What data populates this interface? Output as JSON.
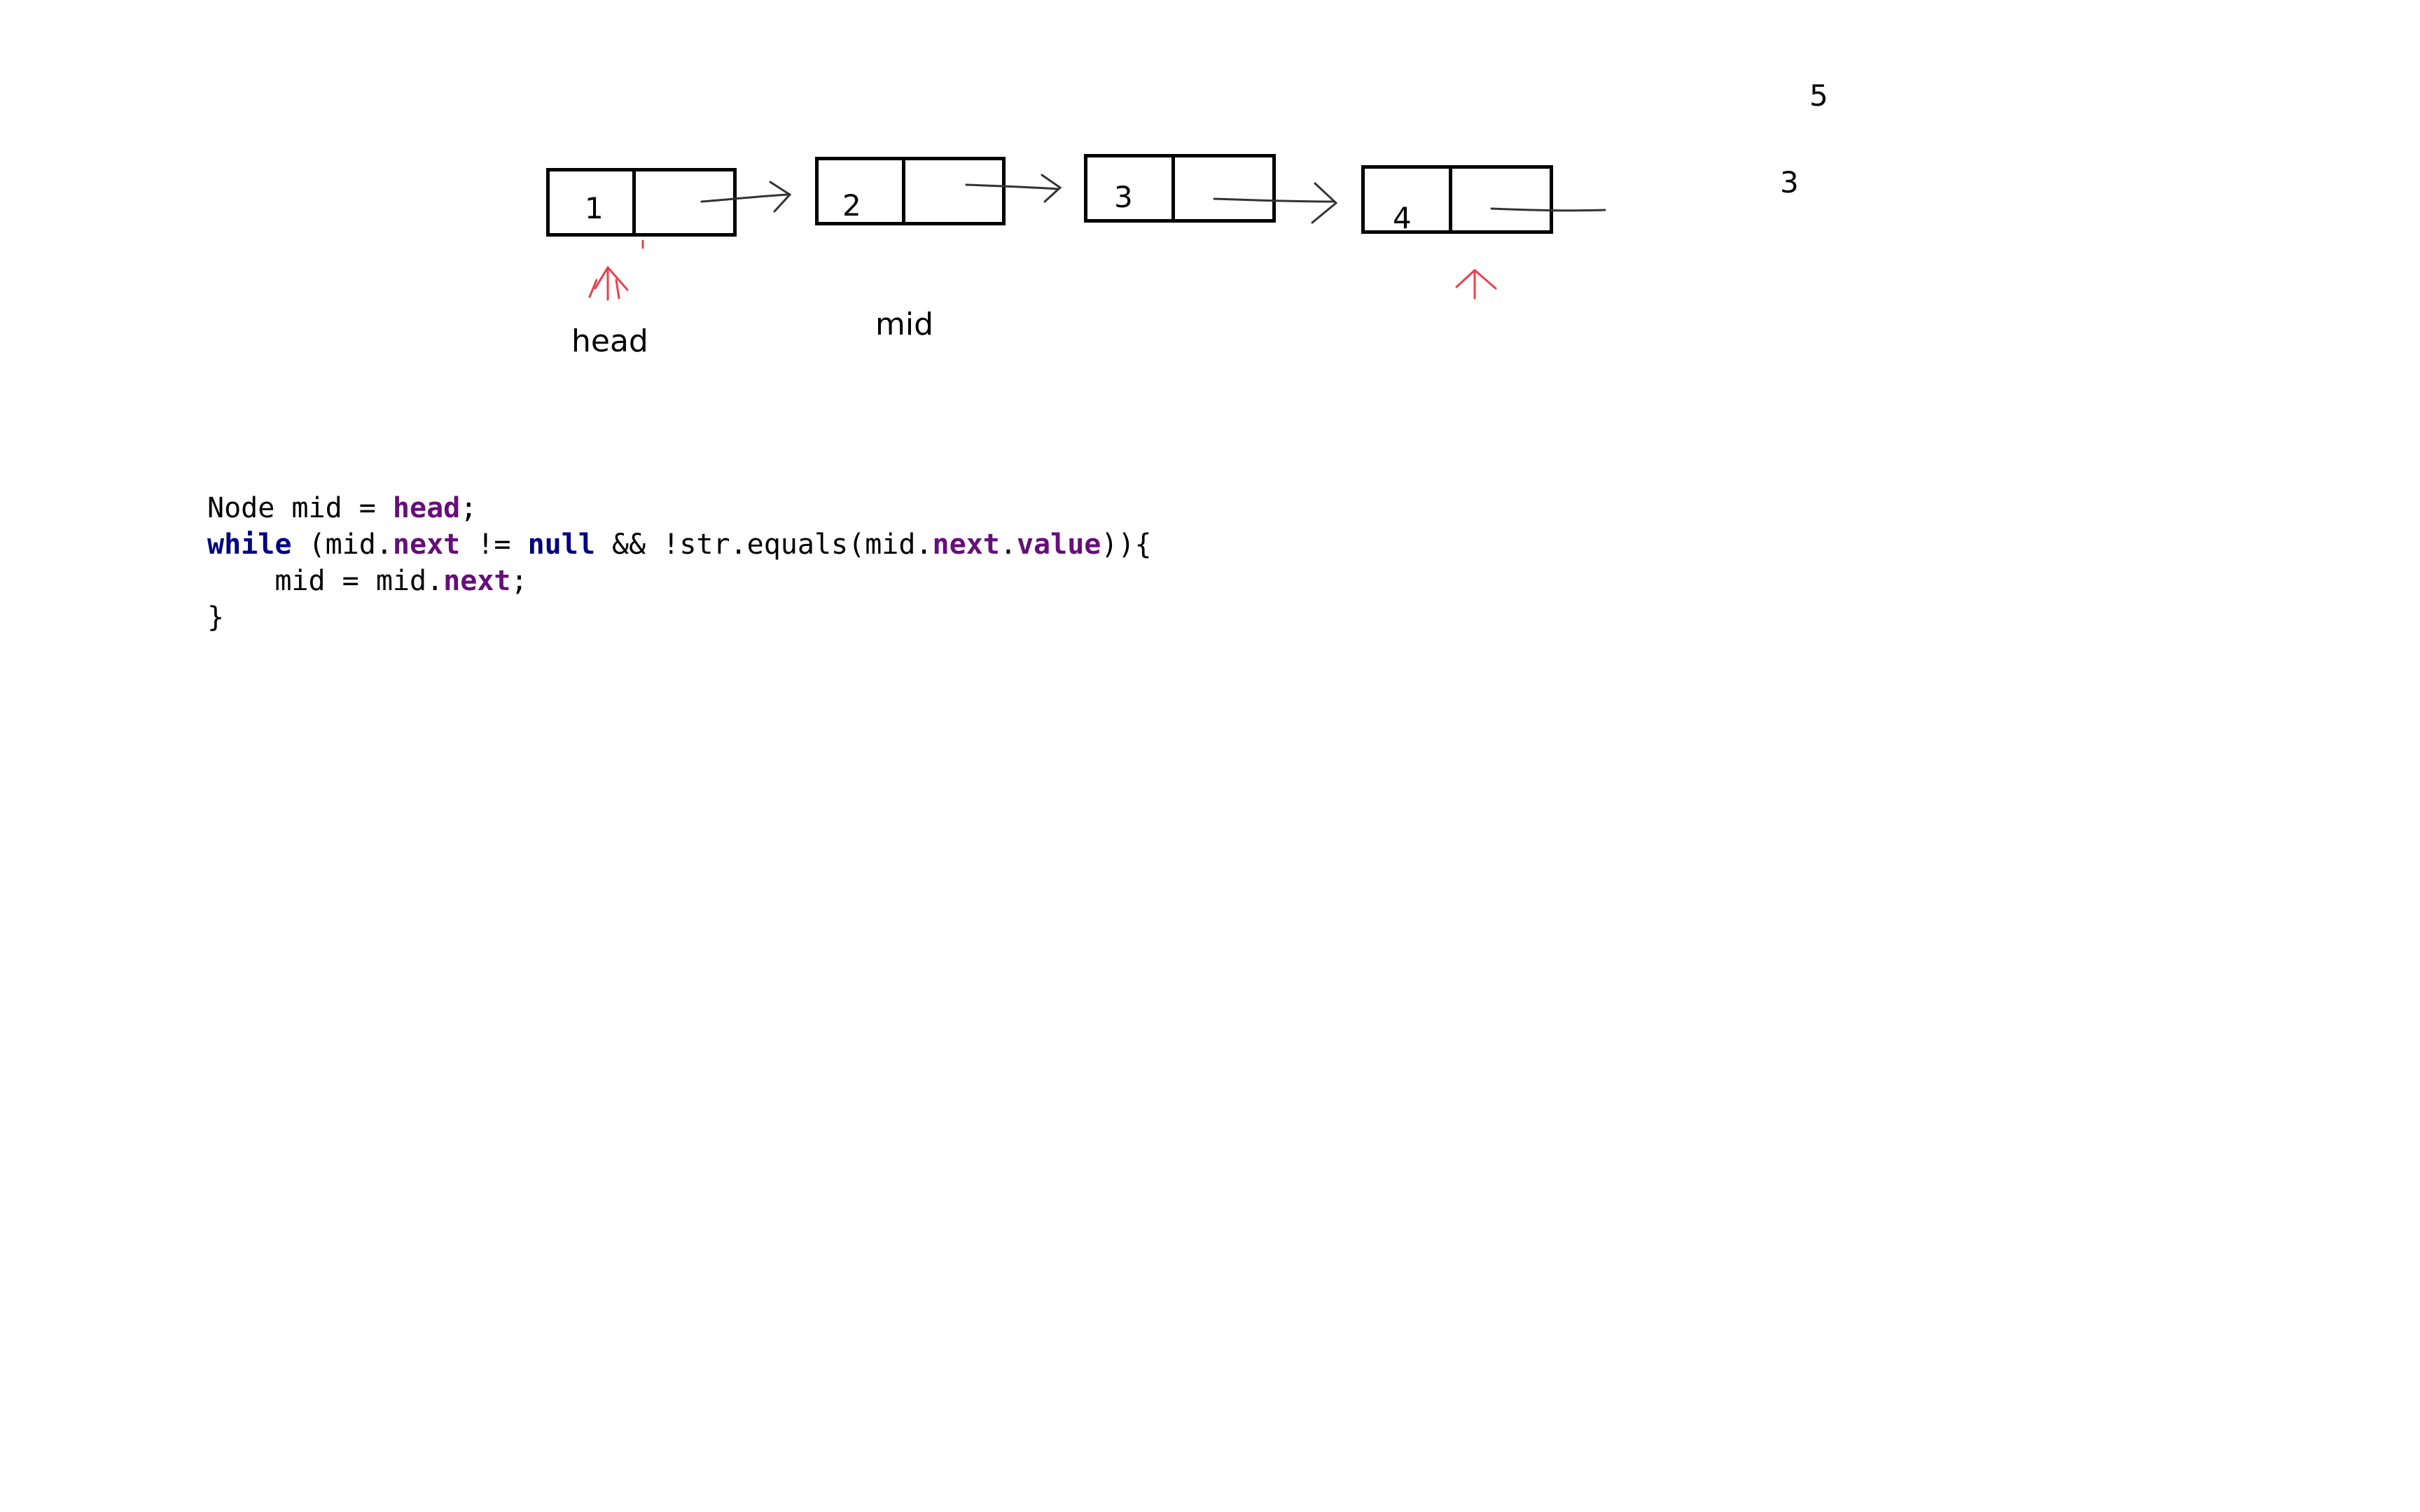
{
  "diagram": {
    "nodes": [
      {
        "value": "1"
      },
      {
        "value": "2"
      },
      {
        "value": "3"
      },
      {
        "value": "4"
      }
    ],
    "pointers": {
      "head_label": "head",
      "mid_label": "mid"
    },
    "side_numbers": [
      "5",
      "3"
    ],
    "colors": {
      "box": "#000000",
      "arrow": "#000000",
      "pointer_marks": "#e8414b"
    }
  },
  "code": {
    "line1": {
      "a": "Node mid = ",
      "b": "head",
      "c": ";"
    },
    "line2": {
      "kw1": "while",
      "a": " (mid.",
      "f1": "next",
      "b": " != ",
      "kw2": "null",
      "c": " && !str.equals(mid.",
      "f2": "next",
      "d": ".",
      "f3": "value",
      "e": ")){"
    },
    "line3": {
      "a": "    mid = mid.",
      "f1": "next",
      "b": ";"
    },
    "line4": {
      "a": "}"
    },
    "colors": {
      "keyword": "#000080",
      "field": "#660e7a"
    }
  }
}
